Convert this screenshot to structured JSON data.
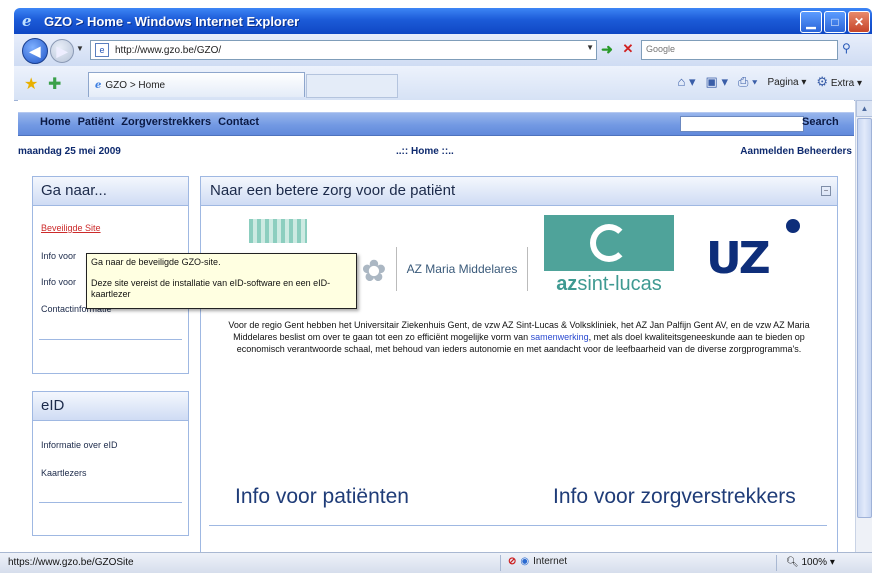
{
  "window": {
    "title": "GZO > Home - Windows Internet Explorer",
    "url": "http://www.gzo.be/GZO/",
    "search_placeholder": "Google",
    "tab_label": "GZO > Home",
    "cmd_pagina": "Pagina",
    "cmd_extra": "Extra"
  },
  "nav": {
    "items": [
      "Home",
      "Patiënt",
      "Zorgverstrekkers",
      "Contact"
    ],
    "search_label": "Search"
  },
  "infobar": {
    "date": "maandag 25 mei 2009",
    "breadcrumb": "..:: Home ::..",
    "login": "Aanmelden Beheerders"
  },
  "sidebar": {
    "box1_title": "Ga naar...",
    "box1_items": [
      "Beveiligde Site",
      "Info voor",
      "Info voor",
      "Contactinformatie"
    ],
    "box2_title": "eID",
    "box2_items": [
      "Informatie over eID",
      "Kaartlezers"
    ]
  },
  "main": {
    "title": "Naar een betere zorg voor de patiënt",
    "logos": {
      "azmm": "AZ Maria Middelares",
      "azsl_prefix": "az",
      "azsl_name": "sint-lucas",
      "uz": "UZ"
    },
    "intro_before": "Voor de regio Gent hebben het Universitair Ziekenhuis Gent, de vzw AZ Sint-Lucas & Volkskliniek, het AZ Jan Palfijn Gent AV, en de vzw AZ Maria Middelares beslist om over te gaan tot een zo efficiënt mogelijke vorm van ",
    "intro_link": "samenwerking",
    "intro_after": ", met als doel kwaliteitsgeneeskunde aan te bieden op economisch verantwoorde schaal, met behoud van ieders autonomie en met aandacht voor de leefbaarheid van de diverse zorgprogramma's.",
    "info_patienten": "Info voor patiënten",
    "info_zorgverstrekkers": "Info voor zorgverstrekkers"
  },
  "tooltip": {
    "line1": "Ga naar de beveiligde GZO-site.",
    "line2": "Deze site vereist de installatie van eID-software en een eID-kaartlezer"
  },
  "status": {
    "url": "https://www.gzo.be/GZOSite",
    "zone": "Internet",
    "zoom": "100%"
  }
}
